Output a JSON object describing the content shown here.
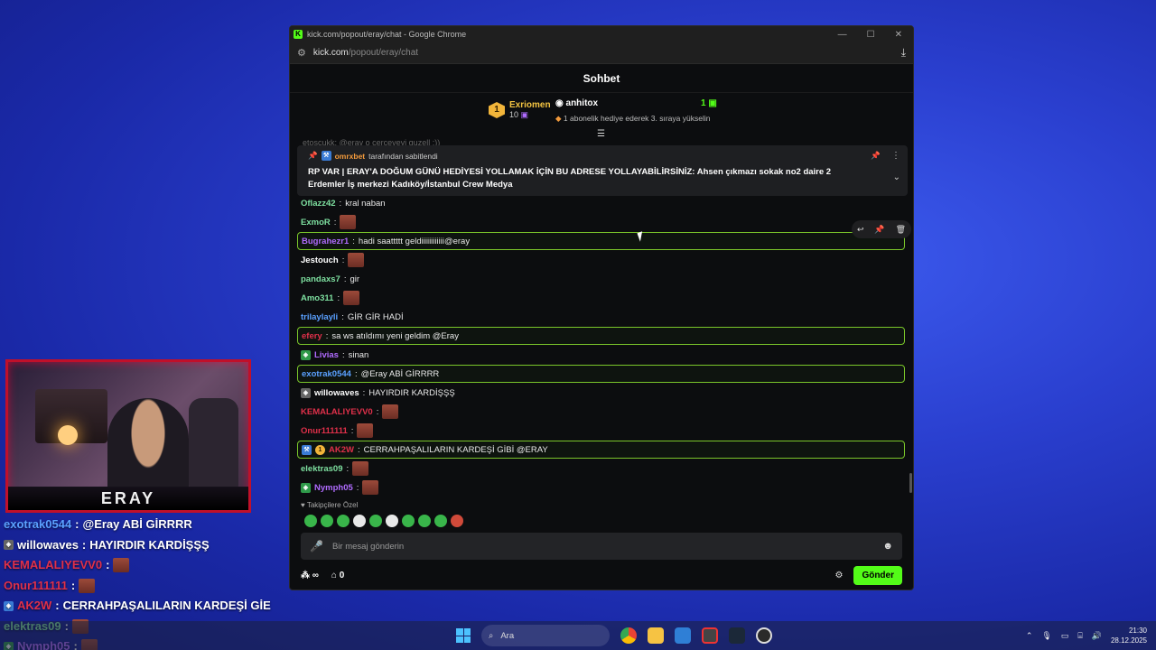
{
  "browser": {
    "title": "kick.com/popout/eray/chat - Google Chrome",
    "url_domain": "kick.com",
    "url_path": "/popout/eray/chat",
    "window_controls": [
      "—",
      "☐",
      "✕"
    ]
  },
  "chat": {
    "header": "Sohbet",
    "leaderboard": {
      "rank": "1",
      "top_name": "Exriomen",
      "top_count": "10",
      "second_name": "anhitox",
      "gift_tip": "1 abonelik hediye ederek 3. sıraya yükselin",
      "right_count": "1"
    },
    "pinned": {
      "by_user": "omrxbet",
      "by_text": "tarafından sabitlendi",
      "message": "RP VAR | ERAY'A DOĞUM GÜNÜ HEDİYESİ YOLLAMAK İÇİN BU ADRESE YOLLAYABİLİRSİNİZ: Ahsen çıkmazı sokak no2 daire 2 Erdemler İş merkezi Kadıköy/İstanbul Crew Medya"
    },
    "hidden_row": "etoscukk: @eray o cerceveyi guzell :))",
    "messages": [
      {
        "user": "Oflazz42",
        "color": "#7ee0a0",
        "text": "kral naban"
      },
      {
        "user": "ExmoR",
        "color": "#7ee0a0",
        "text": ""
      },
      {
        "user": "Bugrahezr1",
        "color": "#b06bff",
        "text": "hadi saattttt geldiiiiiiiiiiii@eray"
      },
      {
        "user": "Jestouch",
        "color": "#ffffff",
        "text": ""
      },
      {
        "user": "pandaxs7",
        "color": "#7ee0a0",
        "text": "gir"
      },
      {
        "user": "Amo311",
        "color": "#7ee0a0",
        "text": ""
      },
      {
        "user": "trilaylayli",
        "color": "#5aa0ff",
        "text": "GİR GİR HADİ"
      },
      {
        "user": "efery",
        "color": "#e0304a",
        "text": "sa ws atıldımı yeni geldim @Eray"
      },
      {
        "user": "Livias",
        "color": "#b06bff",
        "text": "sinan"
      },
      {
        "user": "exotrak0544",
        "color": "#5aa0ff",
        "text": "@Eray ABİ GİRRRR"
      },
      {
        "user": "willowaves",
        "color": "#ffffff",
        "text": "HAYIRDIR KARDİŞŞŞ"
      },
      {
        "user": "KEMALALIYEVV0",
        "color": "#e0304a",
        "text": ""
      },
      {
        "user": "Onur111111",
        "color": "#e0304a",
        "text": ""
      },
      {
        "user": "AK2W",
        "color": "#e0304a",
        "text": "CERRAHPAŞALILARIN KARDEŞİ GİBİ @ERAY"
      },
      {
        "user": "elektras09",
        "color": "#7ee0a0",
        "text": ""
      },
      {
        "user": "Nymph05",
        "color": "#b06bff",
        "text": ""
      }
    ],
    "followers_label": "Takipçilere Özel",
    "input_placeholder": "Bir mesaj gönderin",
    "bottom_count": "0",
    "send_label": "Gönder"
  },
  "overlay": {
    "webcam_name": "ERAY",
    "rows": [
      {
        "user": "exotrak0544",
        "color": "#5aa0ff",
        "text": "@Eray ABİ GİRRRR"
      },
      {
        "user": "willowaves",
        "color": "#ffffff",
        "text": "HAYIRDIR KARDİŞŞŞ"
      },
      {
        "user": "KEMALALIYEVV0",
        "color": "#e0304a",
        "text": ""
      },
      {
        "user": "Onur111111",
        "color": "#e0304a",
        "text": ""
      },
      {
        "user": "AK2W",
        "color": "#e0304a",
        "text": "CERRAHPAŞALILARIN KARDEŞİ GİE"
      },
      {
        "user": "elektras09",
        "color": "#7ee0a0",
        "text": ""
      },
      {
        "user": "Nymph05",
        "color": "#b06bff",
        "text": ""
      }
    ]
  },
  "taskbar": {
    "search_placeholder": "Ara",
    "time": "21:30",
    "date": "28.12.2025"
  },
  "colors": {
    "accent": "#53fc18",
    "pin_author": "#f29a3c"
  }
}
